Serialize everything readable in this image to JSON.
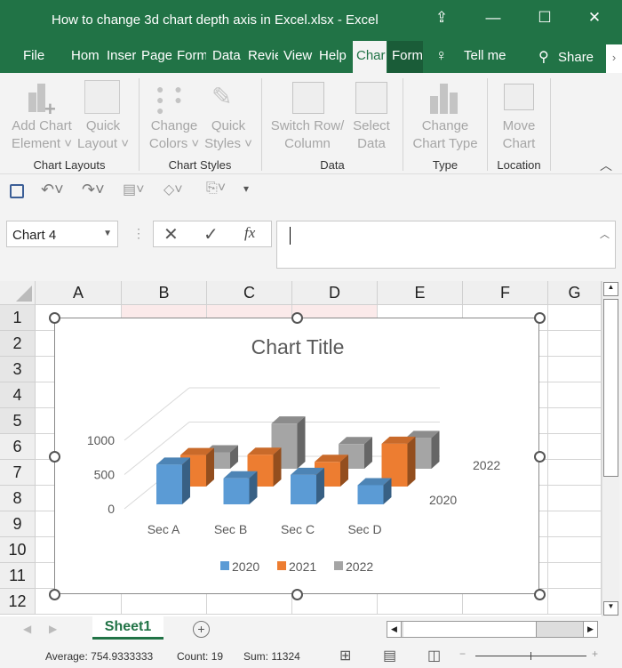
{
  "window": {
    "title": "How to change 3d chart depth axis in Excel.xlsx  -  Excel"
  },
  "tabs": [
    "File",
    "Hom",
    "Inser",
    "Page",
    "Form",
    "Data",
    "Revie",
    "View",
    "Help",
    "Char",
    "Form"
  ],
  "tell_me": "Tell me",
  "share": "Share",
  "ribbon": {
    "buttons": [
      {
        "l1": "Add Chart",
        "l2": "Element ˅"
      },
      {
        "l1": "Quick",
        "l2": "Layout ˅"
      },
      {
        "l1": "Change",
        "l2": "Colors ˅"
      },
      {
        "l1": "Quick",
        "l2": "Styles ˅"
      },
      {
        "l1": "Switch Row/",
        "l2": "Column"
      },
      {
        "l1": "Select",
        "l2": "Data"
      },
      {
        "l1": "Change",
        "l2": "Chart Type"
      },
      {
        "l1": "Move",
        "l2": "Chart"
      }
    ],
    "groups": [
      "Chart Layouts",
      "Chart Styles",
      "Data",
      "Type",
      "Location"
    ]
  },
  "formula": {
    "name_box": "Chart 4",
    "value": ""
  },
  "columns": [
    "A",
    "B",
    "C",
    "D",
    "E",
    "F",
    "G"
  ],
  "rows": [
    "1",
    "2",
    "3",
    "4",
    "5",
    "6",
    "7",
    "8",
    "9",
    "10",
    "11",
    "12"
  ],
  "sheet_tab": "Sheet1",
  "status": {
    "average": "Average: 754.9333333",
    "count": "Count: 19",
    "sum": "Sum: 11324"
  },
  "chart_data": {
    "type": "bar",
    "subtype": "3d-column",
    "title": "Chart Title",
    "categories": [
      "Sec A",
      "Sec B",
      "Sec C",
      "Sec D"
    ],
    "series": [
      {
        "name": "2020",
        "color": "#5b9bd5",
        "values": [
          580,
          380,
          430,
          280
        ]
      },
      {
        "name": "2021",
        "color": "#ed7d31",
        "values": [
          460,
          465,
          360,
          625
        ]
      },
      {
        "name": "2022",
        "color": "#a5a5a5",
        "values": [
          240,
          660,
          360,
          450
        ]
      }
    ],
    "yticks": [
      "0",
      "500",
      "1000"
    ],
    "ylim": [
      0,
      1000
    ],
    "depth_labels": [
      "2022",
      "2020"
    ],
    "legend": "bottom"
  }
}
